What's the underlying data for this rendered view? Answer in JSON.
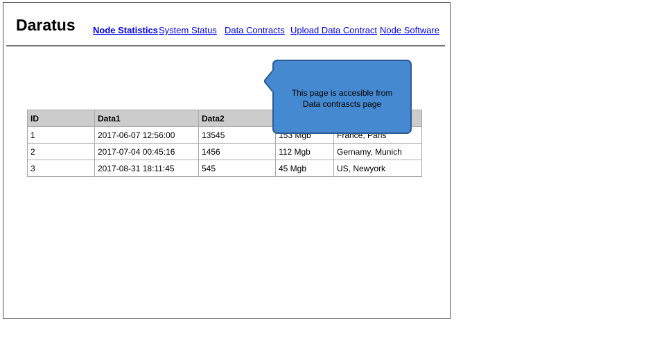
{
  "header": {
    "title": "Daratus",
    "nav": [
      "Node Statistics",
      "System Status",
      "Data Contracts",
      "Upload Data Contract",
      "Node Software"
    ]
  },
  "table": {
    "headers": [
      "ID",
      "Data1",
      "Data2",
      "",
      ""
    ],
    "rows": [
      [
        "1",
        "2017-06-07 12:56:00",
        "13545",
        "153 Mgb",
        "France, Paris"
      ],
      [
        "2",
        "2017-07-04 00:45:16",
        "1456",
        "112 Mgb",
        "Gernamy, Munich"
      ],
      [
        "3",
        "2017-08-31 18:11:45",
        "545",
        "45 Mgb",
        "US, Newyork"
      ]
    ]
  },
  "callout": {
    "line1": "This page is accesible from",
    "line2": "Data contrascts page",
    "color": "#4589d0"
  }
}
